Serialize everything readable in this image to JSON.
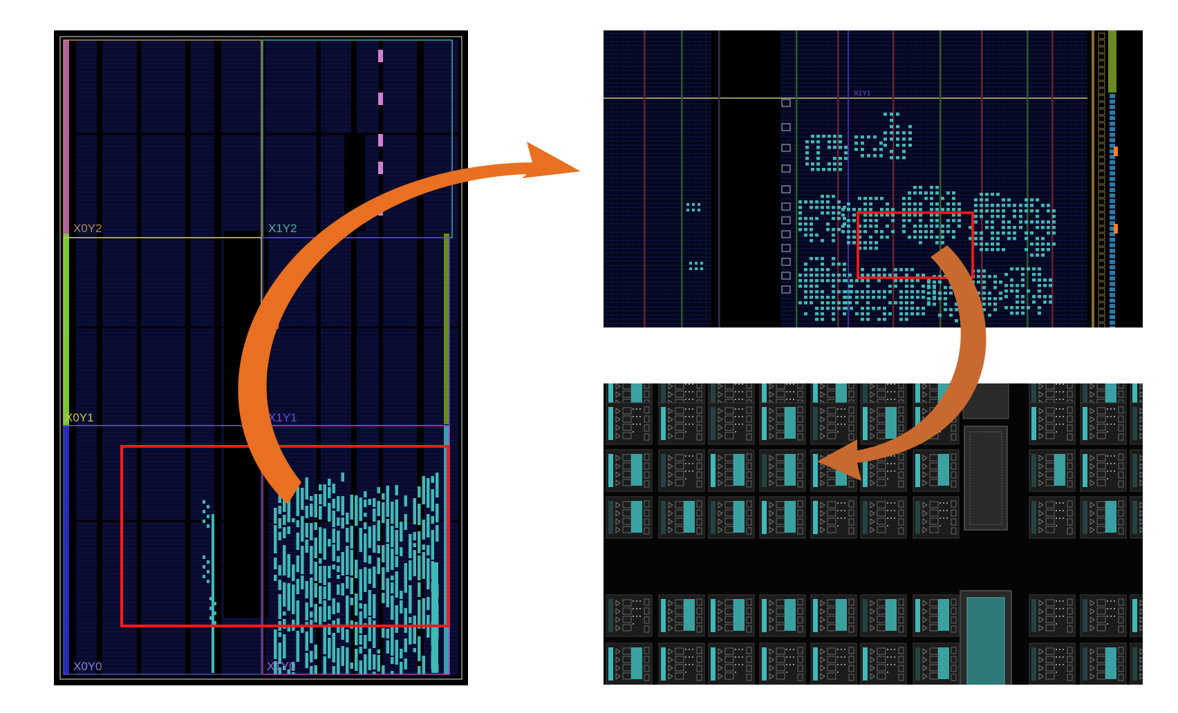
{
  "device_view": {
    "regions": [
      {
        "label": "X0Y2",
        "border": "#c0a060",
        "text_color": "#b08a5a"
      },
      {
        "label": "X1Y2",
        "border": "#3fb8a8",
        "text_color": "#3fb8a8"
      },
      {
        "label": "X0Y1",
        "border": "#c8c878",
        "text_color": "#c8c840"
      },
      {
        "label": "X1Y1",
        "border": "#5a40c8",
        "text_color": "#6a50e0"
      },
      {
        "label": "X0Y0",
        "border": "#5050a8",
        "text_color": "#8a80d8"
      },
      {
        "label": "X1Y0",
        "border": "#c040c0",
        "text_color": "#9a70c8"
      }
    ]
  },
  "zoom_view": {
    "region_label": "X1Y1"
  },
  "colors": {
    "background": "#000000",
    "grid": "#1a1f5c",
    "cell": "#40b8b8",
    "highlight": "#ff1a1a",
    "arrow": "#e87020",
    "block_bg": "#1b1b1b"
  }
}
